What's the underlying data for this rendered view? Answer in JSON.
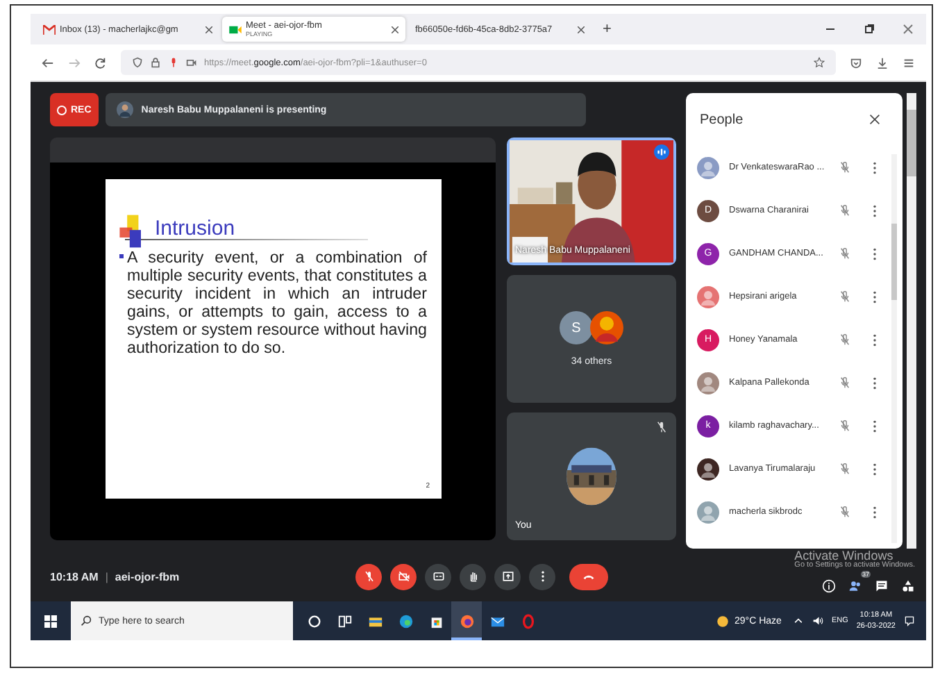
{
  "browser": {
    "tabs": [
      {
        "title": "Inbox (13) - macherlajkc@gm",
        "kind": "mail",
        "selected": false
      },
      {
        "title": "Meet - aei-ojor-fbm",
        "subtitle": "PLAYING",
        "kind": "meet",
        "selected": true
      },
      {
        "title": "fb66050e-fd6b-45ca-8db2-3775a7",
        "kind": "doc",
        "selected": false
      }
    ],
    "new_tab": "+",
    "url": "https://meet.**google.com**/aei-ojor-fbm?pli=1&authuser=0"
  },
  "meet": {
    "recording": "REC",
    "presenting": "Naresh Babu Muppalaneni is presenting",
    "slide": {
      "title": "Intrusion",
      "bullet": "A security event, or a combination of multiple security events, that constitutes a security incident in which an intruder gains, or attempts to gain, access to a system or system resource without having authorization to do so.",
      "page": "2"
    },
    "tiles": [
      {
        "kind": "video",
        "name": "Naresh Babu Muppalaneni",
        "speaking": true
      },
      {
        "kind": "group",
        "letter": "S",
        "color": "#7d8fa0",
        "caption": "34 others"
      },
      {
        "kind": "self",
        "name": "You",
        "muted": true
      }
    ],
    "people": {
      "title": "People",
      "participants": [
        {
          "name": "Dr VenkateswaraRao ...",
          "color": "#8a9bc4",
          "muted": true
        },
        {
          "name": "Dswarna Charanirai",
          "kind": "letter",
          "letter": "D",
          "color": "#6d4c41",
          "muted": true
        },
        {
          "name": "GANDHAM CHANDA...",
          "kind": "letter",
          "letter": "G",
          "color": "#8e24aa",
          "muted": true
        },
        {
          "name": "Hepsirani arigela",
          "color": "#e57373",
          "muted": true
        },
        {
          "name": "Honey Yanamala",
          "kind": "letter",
          "letter": "H",
          "color": "#d81b60",
          "muted": true
        },
        {
          "name": "Kalpana Pallekonda",
          "color": "#a1887f",
          "muted": true
        },
        {
          "name": "kilamb raghavachary...",
          "kind": "letter",
          "letter": "k",
          "color": "#7b1fa2",
          "muted": true
        },
        {
          "name": "Lavanya Tirumalaraju",
          "color": "#3e2723",
          "muted": true
        },
        {
          "name": "macherla sikbrodc",
          "color": "#90a4ae",
          "muted": true
        }
      ]
    },
    "footer": {
      "time": "10:18 AM",
      "separator": "|",
      "meeting_code": "aei-ojor-fbm",
      "controls": [
        {
          "kind": "mic",
          "off": true
        },
        {
          "kind": "camera",
          "off": true
        },
        {
          "kind": "captions",
          "off": false
        },
        {
          "kind": "hand",
          "off": false
        },
        {
          "kind": "present",
          "off": false
        },
        {
          "kind": "more",
          "off": false
        },
        {
          "kind": "end",
          "off": true
        }
      ],
      "side": [
        {
          "kind": "info"
        },
        {
          "kind": "people",
          "badge": "37"
        },
        {
          "kind": "chat"
        },
        {
          "kind": "activities"
        }
      ]
    }
  },
  "watermark": {
    "title": "Activate Windows",
    "subtitle": "Go to Settings to activate Windows."
  },
  "taskbar": {
    "search_placeholder": "Type here to search",
    "apps": [
      {
        "kind": "cortana",
        "selected": false
      },
      {
        "kind": "taskview",
        "selected": false
      },
      {
        "kind": "explorer",
        "selected": false
      },
      {
        "kind": "edge",
        "selected": false
      },
      {
        "kind": "store",
        "selected": false
      },
      {
        "kind": "firefox",
        "selected": true
      },
      {
        "kind": "mail",
        "selected": false
      },
      {
        "kind": "opera",
        "selected": false
      }
    ],
    "weather": "29°C Haze",
    "language": "ENG",
    "time": "10:18 AM",
    "date": "26-03-2022"
  }
}
